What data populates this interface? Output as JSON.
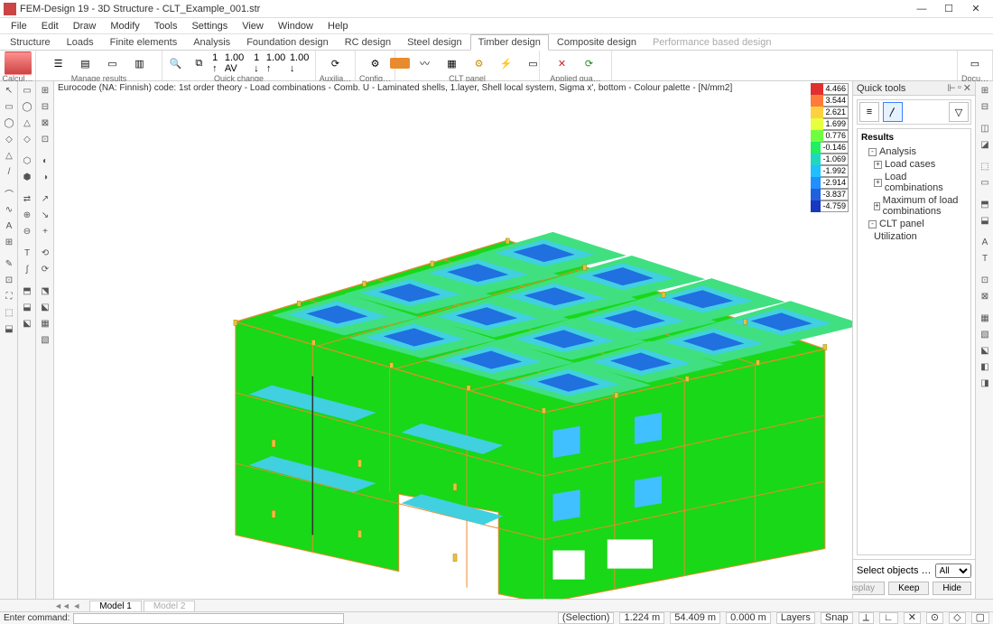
{
  "titlebar": {
    "app_title": "FEM-Design 19 - 3D Structure - CLT_Example_001.str"
  },
  "menubar": [
    "File",
    "Edit",
    "Draw",
    "Modify",
    "Tools",
    "Settings",
    "View",
    "Window",
    "Help"
  ],
  "ribbon_tabs": [
    {
      "label": "Structure",
      "active": false
    },
    {
      "label": "Loads",
      "active": false
    },
    {
      "label": "Finite elements",
      "active": false
    },
    {
      "label": "Analysis",
      "active": false
    },
    {
      "label": "Foundation design",
      "active": false
    },
    {
      "label": "RC design",
      "active": false
    },
    {
      "label": "Steel design",
      "active": false
    },
    {
      "label": "Timber design",
      "active": true
    },
    {
      "label": "Composite design",
      "active": false
    },
    {
      "label": "Performance based design",
      "active": false,
      "disabled": true
    }
  ],
  "ribbon_groups": {
    "calcul": "Calcul…",
    "manage": "Manage results",
    "quick": "Quick change",
    "auxilia": "Auxilia…",
    "config": "Config…",
    "clt": "CLT panel",
    "applied": "Applied qua…",
    "docu": "Docu…",
    "incr1": "1 ↑",
    "incr_av": "1.00 AV",
    "incr2": "1 ↓",
    "incr100a": "1.00 ↑",
    "incr100b": "1.00 ↓"
  },
  "viewport": {
    "header": "Eurocode (NA: Finnish) code: 1st order theory - Load combinations - Comb. U - Laminated shells, 1.layer, Shell local system, Sigma x', bottom - Colour palette - [N/mm2]"
  },
  "legend": [
    {
      "color": "#e03030",
      "value": "4.466"
    },
    {
      "color": "#ff7b39",
      "value": "3.544"
    },
    {
      "color": "#ffd040",
      "value": "2.621"
    },
    {
      "color": "#e8ff40",
      "value": "1.699"
    },
    {
      "color": "#70ff40",
      "value": "0.776"
    },
    {
      "color": "#20f060",
      "value": "-0.146"
    },
    {
      "color": "#20d8c0",
      "value": "-1.069"
    },
    {
      "color": "#20c0ff",
      "value": "-1.992"
    },
    {
      "color": "#2090ff",
      "value": "-2.914"
    },
    {
      "color": "#2060e0",
      "value": "-3.837"
    },
    {
      "color": "#1838c0",
      "value": "-4.759"
    }
  ],
  "quick": {
    "title": "Quick tools",
    "results_title": "Results",
    "tree": [
      {
        "label": "Analysis",
        "level": 0,
        "expand": "-"
      },
      {
        "label": "Load cases",
        "level": 1,
        "expand": "+"
      },
      {
        "label": "Load combinations",
        "level": 1,
        "expand": "+"
      },
      {
        "label": "Maximum of load combinations",
        "level": 1,
        "expand": "+"
      },
      {
        "label": "CLT panel",
        "level": 0,
        "expand": "-"
      },
      {
        "label": "Utilization",
        "level": 1,
        "expand": ""
      }
    ],
    "select_label": "Select objects …",
    "select_value": "All",
    "btn_display": "Display",
    "btn_keep": "Keep",
    "btn_hide": "Hide"
  },
  "view_tabs": [
    "Model 1",
    "Model 2"
  ],
  "command": {
    "label": "Enter command:",
    "selection": "(Selection)",
    "coords": [
      "1.224 m",
      "54.409 m",
      "0.000 m"
    ],
    "layers": "Layers",
    "snap": "Snap"
  }
}
